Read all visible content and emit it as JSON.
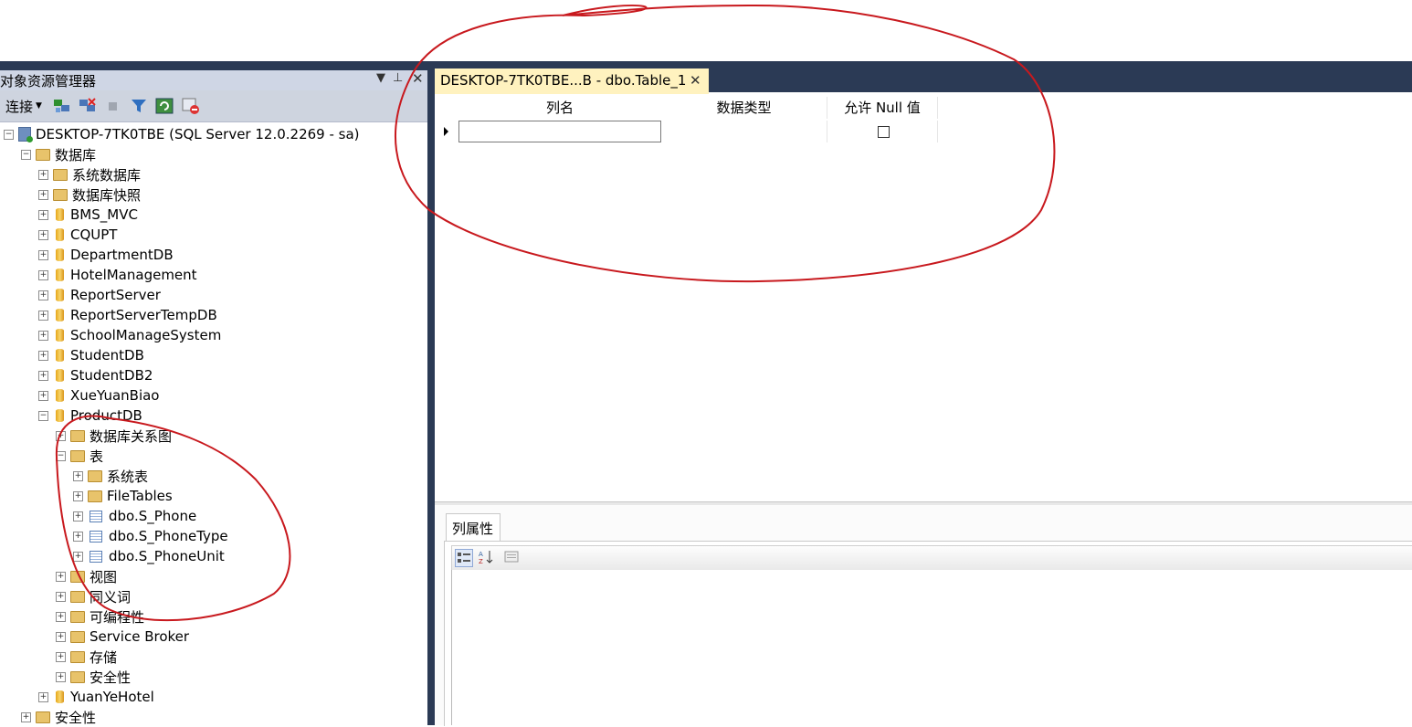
{
  "object_explorer": {
    "title": "对象资源管理器",
    "toolbar": {
      "connect_label": "连接",
      "icons": [
        "connect-object-explorer-icon",
        "disconnect-icon",
        "stop-icon",
        "filter-icon",
        "refresh-icon",
        "activity-monitor-icon"
      ]
    },
    "tree": {
      "server": "DESKTOP-7TK0TBE (SQL Server 12.0.2269 - sa)",
      "databases_label": "数据库",
      "items": [
        "系统数据库",
        "数据库快照",
        "BMS_MVC",
        "CQUPT",
        "DepartmentDB",
        "HotelManagement",
        "ReportServer",
        "ReportServerTempDB",
        "SchoolManageSystem",
        "StudentDB",
        "StudentDB2",
        "XueYuanBiao",
        "ProductDB"
      ],
      "productdb_children": [
        "数据库关系图",
        "表",
        "视图",
        "同义词",
        "可编程性",
        "Service Broker",
        "存储",
        "安全性"
      ],
      "tables_children": [
        "系统表",
        "FileTables",
        "dbo.S_Phone",
        "dbo.S_PhoneType",
        "dbo.S_PhoneUnit"
      ],
      "after_items": [
        "YuanYeHotel"
      ],
      "server_security": "安全性"
    }
  },
  "document": {
    "tab_title": "DESKTOP-7TK0TBE...B - dbo.Table_1",
    "close_glyph": "✕",
    "columns": [
      "列名",
      "数据类型",
      "允许 Null 值"
    ]
  },
  "properties": {
    "tab_label": "列属性"
  },
  "colors": {
    "chrome_dark": "#2b3a55",
    "tab_active": "#fff2bf",
    "annotation": "#c8191e"
  }
}
